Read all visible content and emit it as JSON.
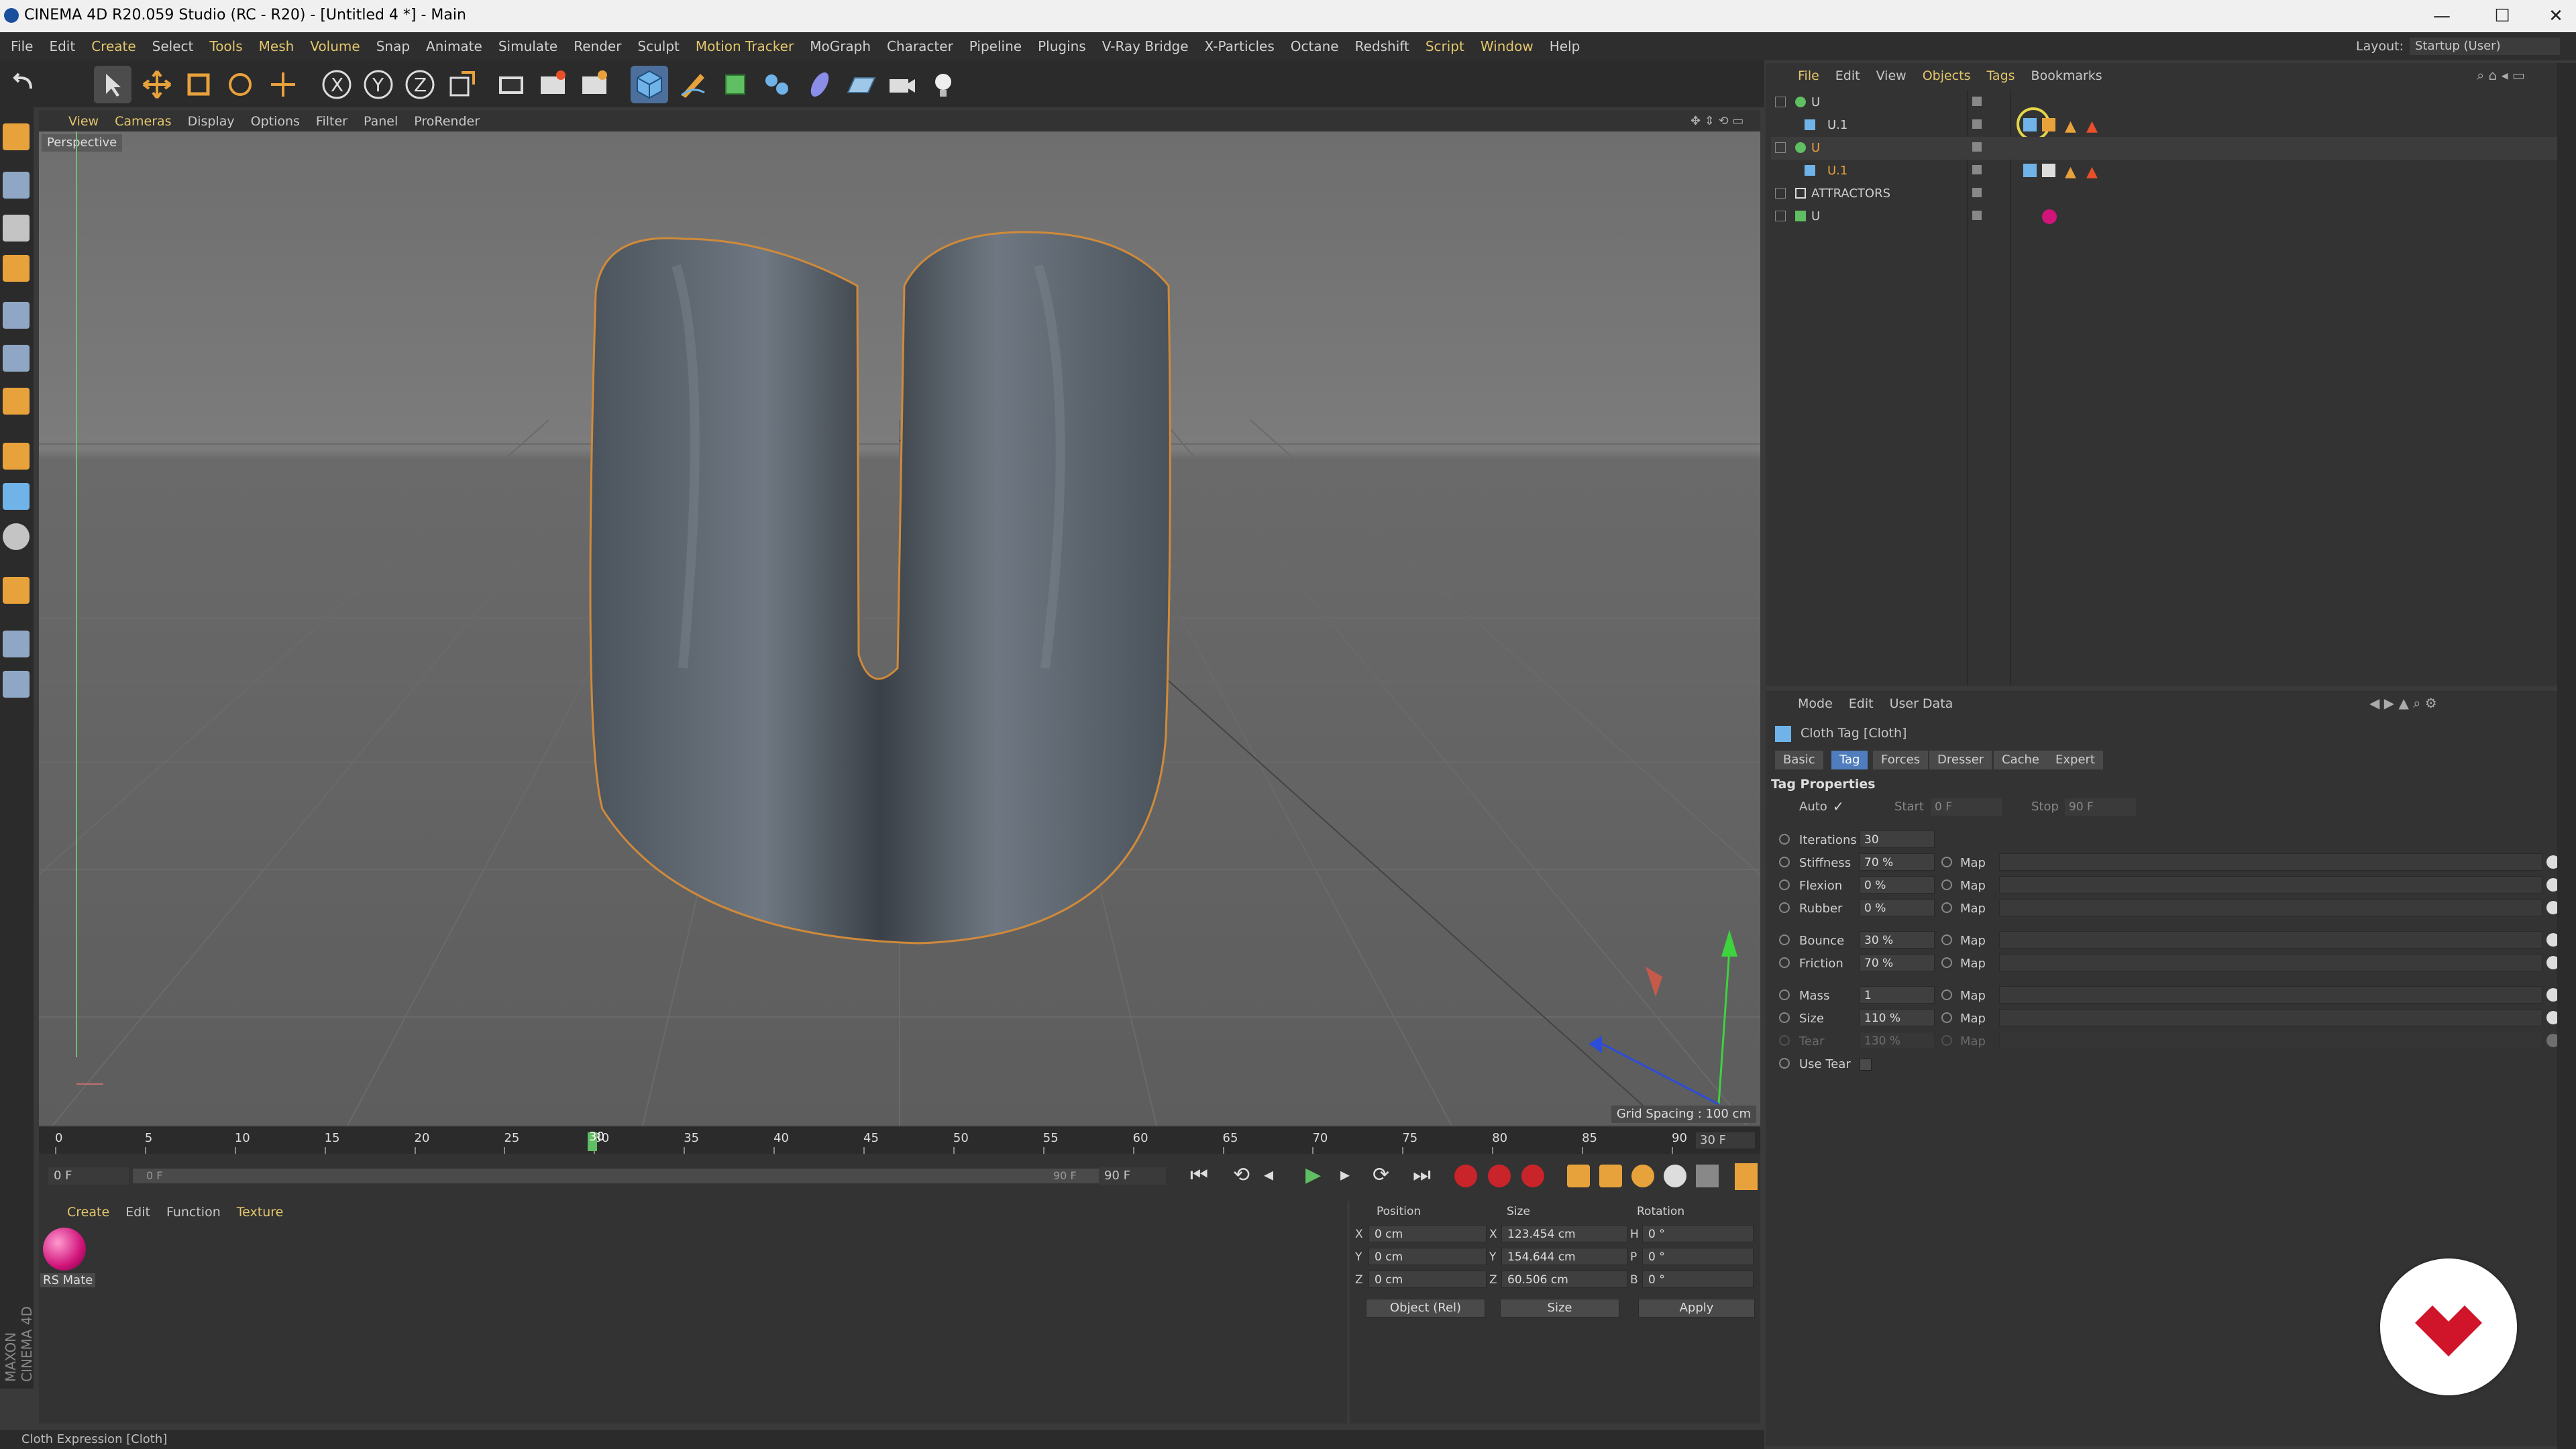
{
  "window": {
    "title": "CINEMA 4D R20.059 Studio (RC - R20) - [Untitled 4 *] - Main",
    "minimize": "—",
    "maximize": "☐",
    "close": "✕"
  },
  "menubar": {
    "items": [
      "File",
      "Edit",
      "Create",
      "Select",
      "Tools",
      "Mesh",
      "Volume",
      "Snap",
      "Animate",
      "Simulate",
      "Render",
      "Sculpt",
      "Motion Tracker",
      "MoGraph",
      "Character",
      "Pipeline",
      "Plugins",
      "V-Ray Bridge",
      "X-Particles",
      "Octane",
      "Redshift",
      "Script",
      "Window",
      "Help"
    ],
    "highlighted": [
      "Create",
      "Tools",
      "Mesh",
      "Volume",
      "Motion Tracker",
      "Script",
      "Window"
    ],
    "layout_label": "Layout:",
    "layout_value": "Startup (User)"
  },
  "viewport": {
    "menu": [
      "View",
      "Cameras",
      "Display",
      "Options",
      "Filter",
      "Panel",
      "ProRender"
    ],
    "name": "Perspective",
    "grid_spacing": "Grid Spacing : 100 cm"
  },
  "timeline": {
    "ticks": [
      "0",
      "5",
      "10",
      "15",
      "20",
      "25",
      "30",
      "35",
      "40",
      "45",
      "50",
      "55",
      "60",
      "65",
      "70",
      "75",
      "80",
      "85",
      "90"
    ],
    "current_frame": "30",
    "end_frame": "30 F",
    "start_field": "0 F",
    "range_start": "0 F",
    "range_end": "90 F",
    "end_field": "90 F"
  },
  "material_manager": {
    "menu": [
      "Create",
      "Edit",
      "Function",
      "Texture"
    ],
    "material_name": "RS Mate"
  },
  "coordinates": {
    "headers": [
      "Position",
      "Size",
      "Rotation"
    ],
    "rows": [
      {
        "axis": "X",
        "pos": "0 cm",
        "size_axis": "X",
        "size": "123.454 cm",
        "rot_axis": "H",
        "rot": "0 °"
      },
      {
        "axis": "Y",
        "pos": "0 cm",
        "size_axis": "Y",
        "size": "154.644 cm",
        "rot_axis": "P",
        "rot": "0 °"
      },
      {
        "axis": "Z",
        "pos": "0 cm",
        "size_axis": "Z",
        "size": "60.506 cm",
        "rot_axis": "B",
        "rot": "0 °"
      }
    ],
    "mode_select": "Object (Rel)",
    "size_select": "Size",
    "apply": "Apply"
  },
  "object_manager": {
    "menu": [
      "File",
      "Edit",
      "View",
      "Objects",
      "Tags",
      "Bookmarks"
    ],
    "rows": [
      {
        "name": "U",
        "level": 0
      },
      {
        "name": "U.1",
        "level": 1
      },
      {
        "name": "U",
        "level": 0
      },
      {
        "name": "U.1",
        "level": 1
      },
      {
        "name": "ATTRACTORS",
        "level": 0
      },
      {
        "name": "U",
        "level": 0
      }
    ]
  },
  "attributes": {
    "menu": [
      "Mode",
      "Edit",
      "User Data"
    ],
    "title": "Cloth Tag [Cloth]",
    "tabs": [
      "Basic",
      "Tag",
      "Forces",
      "Dresser",
      "Cache",
      "Expert"
    ],
    "active_tab": "Tag",
    "section": "Tag Properties",
    "auto_label": "Auto",
    "auto_check": "✓",
    "start_label": "Start",
    "start_value": "0 F",
    "stop_label": "Stop",
    "stop_value": "90 F",
    "properties": [
      {
        "label": "Iterations",
        "value": "30",
        "map": ""
      },
      {
        "label": "Stiffness",
        "value": "70 %",
        "map": "Map"
      },
      {
        "label": "Flexion",
        "value": "0 %",
        "map": "Map"
      },
      {
        "label": "Rubber",
        "value": "0 %",
        "map": "Map"
      },
      {
        "label": "Bounce",
        "value": "30 %",
        "map": "Map"
      },
      {
        "label": "Friction",
        "value": "70 %",
        "map": "Map"
      },
      {
        "label": "Mass",
        "value": "1",
        "map": "Map"
      },
      {
        "label": "Size",
        "value": "110 %",
        "map": "Map"
      },
      {
        "label": "Tear",
        "value": "130 %",
        "map": "Map"
      }
    ],
    "use_tear": "Use Tear"
  },
  "status_bar": {
    "text": "Cloth Expression [Cloth]"
  },
  "brand": {
    "side_logo": "MAXON CINEMA 4D"
  },
  "colors": {
    "accent_blue": "#4f7dbd",
    "highlight_yellow": "#e3c66d",
    "tag_orange": "#e8a23c",
    "badge_red": "#d0142a"
  },
  "icons": [
    "undo-icon",
    "move-icon",
    "scale-icon",
    "rotate-icon",
    "x-axis-icon",
    "y-axis-icon",
    "z-axis-icon",
    "render-icon",
    "cube-icon",
    "pen-icon",
    "light-icon",
    "camera-icon",
    "play-icon",
    "cloth-tag-icon"
  ]
}
